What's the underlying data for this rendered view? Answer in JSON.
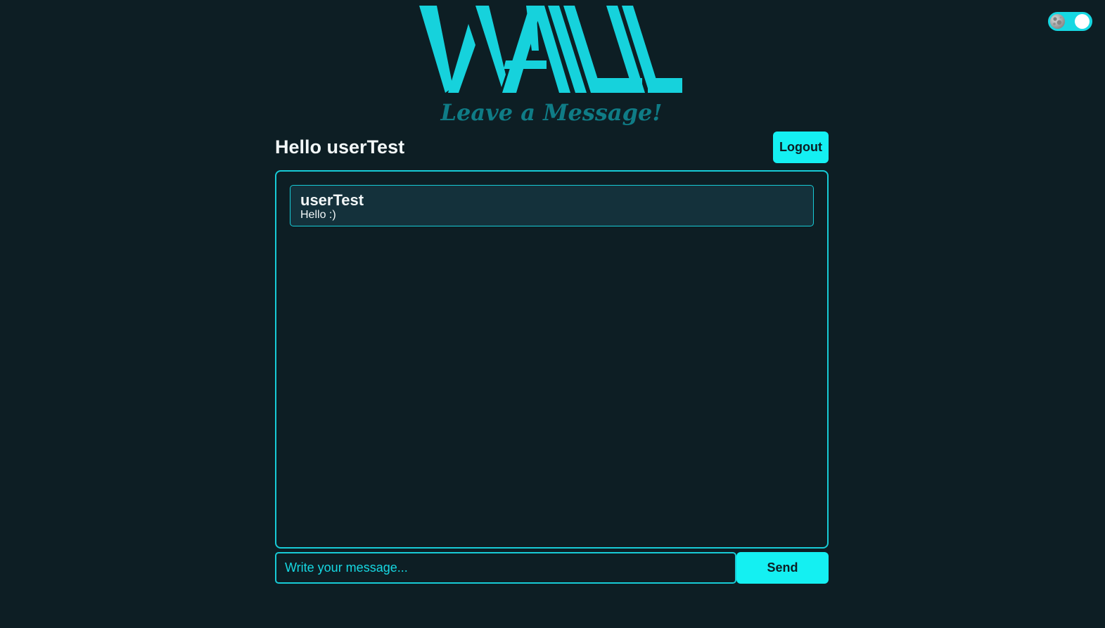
{
  "theme_toggle": {
    "icon": "moon-icon",
    "state": "dark"
  },
  "logo": {
    "wordmark": "WALL",
    "tagline": "Leave a Message!"
  },
  "header": {
    "greeting_prefix": "Hello",
    "username": "userTest",
    "logout_label": "Logout"
  },
  "messages": [
    {
      "author": "userTest",
      "text": "Hello :)"
    }
  ],
  "composer": {
    "placeholder": "Write your message...",
    "value": "",
    "send_label": "Send"
  },
  "colors": {
    "background": "#0d1e24",
    "accent": "#14f0f2",
    "logo": "#16d2dc",
    "tagline": "#0f7c86",
    "border": "#17cbd6",
    "message_bg": "#14313b",
    "text": "#f2f7f8"
  }
}
